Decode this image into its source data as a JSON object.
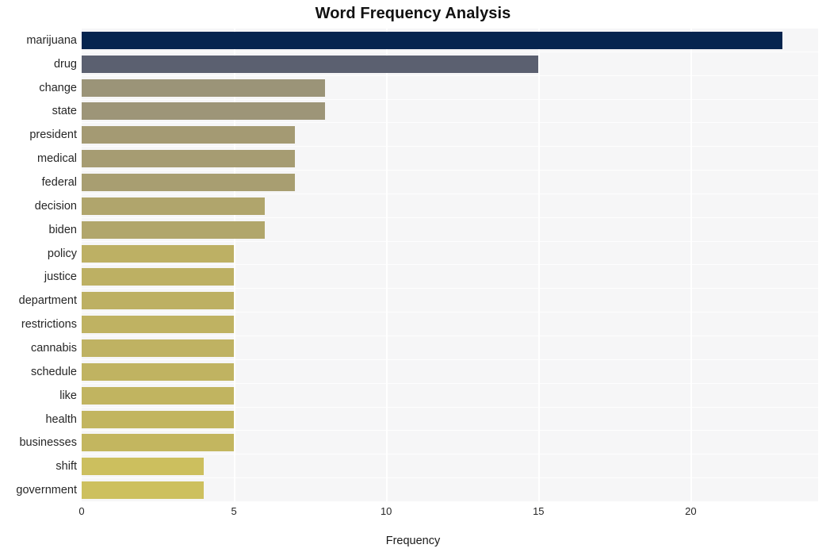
{
  "chart_data": {
    "type": "bar",
    "orientation": "horizontal",
    "title": "Word Frequency Analysis",
    "xlabel": "Frequency",
    "ylabel": "",
    "categories": [
      "marijuana",
      "drug",
      "change",
      "state",
      "president",
      "medical",
      "federal",
      "decision",
      "biden",
      "policy",
      "justice",
      "department",
      "restrictions",
      "cannabis",
      "schedule",
      "like",
      "health",
      "businesses",
      "shift",
      "government"
    ],
    "values": [
      23,
      15,
      8,
      8,
      7,
      7,
      7,
      6,
      6,
      5,
      5,
      5,
      5,
      5,
      5,
      5,
      5,
      5,
      4,
      4
    ],
    "bar_colors": [
      "#06254f",
      "#5b6070",
      "#9b9478",
      "#9d9578",
      "#a49a73",
      "#a69c72",
      "#a89e71",
      "#b0a56c",
      "#b1a66b",
      "#bdb064",
      "#bdb063",
      "#bdb063",
      "#bfb262",
      "#bfb262",
      "#c0b361",
      "#c1b460",
      "#c2b55f",
      "#c3b65f",
      "#ccbf5e",
      "#cdc05e"
    ],
    "xlim": [
      0,
      24.18
    ],
    "xticks": [
      0,
      5,
      10,
      15,
      20
    ],
    "xticklabels": [
      "0",
      "5",
      "10",
      "15",
      "20"
    ],
    "grid": true,
    "grid_axis": "x",
    "legend": false,
    "plot_background": "#f6f6f7",
    "figure_background": "#ffffff",
    "gridline_color": "#ffffff"
  }
}
